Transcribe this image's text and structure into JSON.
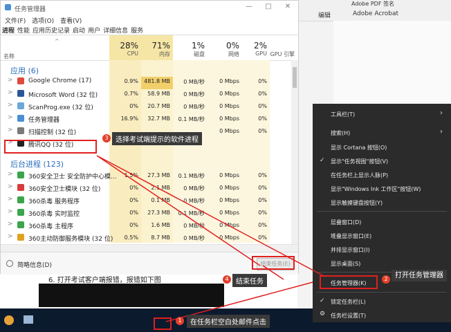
{
  "window": {
    "title": "任务管理器",
    "min": "—",
    "max": "□",
    "close": "✕"
  },
  "menu": [
    "文件(F)",
    "选项(O)",
    "查看(V)"
  ],
  "tabs": [
    "进程",
    "性能",
    "应用历史记录",
    "启动",
    "用户",
    "详细信息",
    "服务"
  ],
  "header": {
    "name": "名称",
    "sort_arrow": "^",
    "cpu_pct": "28%",
    "cpu": "CPU",
    "mem_pct": "71%",
    "mem": "内存",
    "disk_pct": "1%",
    "disk": "磁盘",
    "net_pct": "0%",
    "net": "网络",
    "gpu_pct": "2%",
    "gpu": "GPU",
    "gpu_engine": "GPU 引擎"
  },
  "sections": {
    "apps": "应用 (6)",
    "bg": "后台进程 (123)"
  },
  "apps": [
    {
      "name": "Google Chrome (17)",
      "cpu": "0.9%",
      "mem": "481.8 MB",
      "disk": "0 MB/秒",
      "net": "0 Mbps",
      "gpu": "0%",
      "icon_color": "#dc4b3e"
    },
    {
      "name": "Microsoft Word (32 位)",
      "cpu": "0.7%",
      "mem": "58.9 MB",
      "disk": "0 MB/秒",
      "net": "0 Mbps",
      "gpu": "0%",
      "icon_color": "#2b579a"
    },
    {
      "name": "ScanProg.exe (32 位)",
      "cpu": "0%",
      "mem": "20.7 MB",
      "disk": "0 MB/秒",
      "net": "0 Mbps",
      "gpu": "0%",
      "icon_color": "#6aa8d8"
    },
    {
      "name": "任务管理器",
      "cpu": "16.9%",
      "mem": "32.7 MB",
      "disk": "0.1 MB/秒",
      "net": "0 Mbps",
      "gpu": "0%",
      "icon_color": "#4a8fd6"
    },
    {
      "name": "扫描控制 (32 位)",
      "cpu": "",
      "mem": "",
      "disk": "",
      "net": "0 Mbps",
      "gpu": "0%",
      "icon_color": "#7a7a7a"
    },
    {
      "name": "腾讯QQ (32 位)",
      "cpu": "0.3%",
      "mem": "91.0 MB",
      "disk": "",
      "net": "",
      "gpu": "",
      "icon_color": "#222222"
    }
  ],
  "bg_procs": [
    {
      "name": "360安全卫士 安全防护中心模...",
      "cpu": "1.5%",
      "mem": "27.3 MB",
      "disk": "0.1 MB/秒",
      "net": "0 Mbps",
      "gpu": "0%",
      "icon_color": "#3aa54b"
    },
    {
      "name": "360安全卫士模块 (32 位)",
      "cpu": "0%",
      "mem": "2.1 MB",
      "disk": "0 MB/秒",
      "net": "0 Mbps",
      "gpu": "0%",
      "icon_color": "#d83b3b"
    },
    {
      "name": "360杀毒 服务程序",
      "cpu": "0%",
      "mem": "0.1 MB",
      "disk": "0 MB/秒",
      "net": "0 Mbps",
      "gpu": "0%",
      "icon_color": "#3aa54b"
    },
    {
      "name": "360杀毒 实时监控",
      "cpu": "0%",
      "mem": "27.3 MB",
      "disk": "0.1 MB/秒",
      "net": "0 Mbps",
      "gpu": "0%",
      "icon_color": "#3aa54b"
    },
    {
      "name": "360杀毒 主程序",
      "cpu": "0%",
      "mem": "1.6 MB",
      "disk": "0 MB/秒",
      "net": "0 Mbps",
      "gpu": "0%",
      "icon_color": "#3aa54b"
    },
    {
      "name": "360主动防御服务模块 (32 位)",
      "cpu": "0.5%",
      "mem": "8.7 MB",
      "disk": "0 MB/秒",
      "net": "0 Mbps",
      "gpu": "0%",
      "icon_color": "#e0a020"
    }
  ],
  "footer": {
    "brief": "简略信息(D)",
    "end_task": "结束任务(E)"
  },
  "doc_line": "6. 打开考试客户端报错，报错如下图",
  "ribbon": {
    "edit": "编辑",
    "acrobat": "Adobe Acrobat",
    "top1": "Adobe PDF 签名"
  },
  "context_menu": {
    "toolbar": "工具栏(T)",
    "search": "搜索(H)",
    "cortana": "显示 Cortana 按钮(O)",
    "taskview": "显示\"任务视图\"按钮(V)",
    "people": "在任务栏上显示人脉(P)",
    "ink": "显示\"Windows Ink 工作区\"按钮(W)",
    "touchkb": "显示触摸键盘按钮(Y)",
    "cascade": "层叠窗口(D)",
    "stack": "堆叠显示窗口(E)",
    "side": "并排显示窗口(I)",
    "desktop": "显示桌面(S)",
    "taskmgr": "任务管理器(K)",
    "lock": "锁定任务栏(L)",
    "settings": "任务栏设置(T)",
    "chev": "›",
    "check": "✓",
    "gear": "⚙"
  },
  "annotations": {
    "step1_num": "1",
    "step1": "在任务栏空白处邮件点击",
    "step2_num": "2",
    "step2": "打开任务管理器",
    "step3_num": "3",
    "step3": "选择考试端提示的软件进程",
    "step4_num": "4",
    "step4": "结束任务",
    "color": "#e02020"
  }
}
